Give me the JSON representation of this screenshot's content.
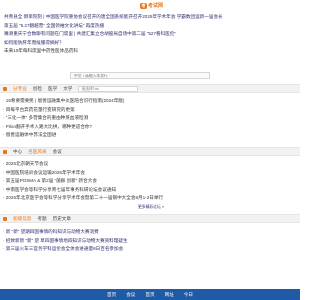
{
  "logo": {
    "mark": "考试",
    "text": "考试网"
  },
  "news_top": [
    "共青县全 倒单院刻 | 中国医学院重协会议召开的唐全国系统能开召开2025年学术年会 学霸数团运新一届会长",
    "第五届 “5.27翻越营” 全国领袖文化讲坛” 再度热播",
    "嘴滑重庆宁合数聊有问题在门席里 | 共建汇集立合胡股局自场中第二届 “527看科医伦”",
    "如何能防肝年而候服得摘好？",
    "未来10年每科席里中药性医体品药科"
  ],
  "search_top": {
    "placeholder": "中文 • 请输入本发行"
  },
  "section1": {
    "tabs": [
      "分专业",
      "创检",
      "医学",
      "文学"
    ],
    "search_placeholder": "请选择Tab",
    "items": [
      "· 16希要需要民 | 偿善运融集中炎医陪合识行指南(2024年版)",
      "· 目每平台奔药花量行变研究的更第",
      "· “三化一体” 多营集合的重由种蒸血液检测",
      "· Pilon翻开手术入路大比拼，哪种更适合你?",
      "· 偿善运融体中苏法全国进"
    ]
  },
  "section2": {
    "tabs": [
      "中心",
      "名医风采",
      "会议"
    ],
    "items": [
      "· 2025北京朝天节会议",
      "· 中国医院培训会议运输2025年学术年会",
      "· 第五届POSMA & 第2届 “菌群 创新” 新合大会",
      "· 中南医学会等科学分享青七届年事务科研论坛会议通知",
      "· 2025年北京医学会等科学分享学术年会暨第二十一届钢中大全会8月1-2日举行"
    ],
    "more": "更多精彩论坛 »"
  },
  "section3": {
    "tabs": [
      "初级信息",
      "考题",
      "历史文章"
    ],
    "items": [
      "· 新 “新” 望期四国事情的科知识与动物大赛消费",
      "· 招致新新 “新” 望 草四国事情地四知识与动物大赛资料理疑生",
      "· 第三届火车三官务学科运伦会全体会进通量8日百名参加会"
    ]
  },
  "footer": {
    "links": [
      "首页",
      "会议",
      "首页",
      "网址",
      "今日"
    ]
  },
  "colors": {
    "accent": "#e8761a",
    "link": "#2c2c6e",
    "footer": "#1f5aa6"
  }
}
